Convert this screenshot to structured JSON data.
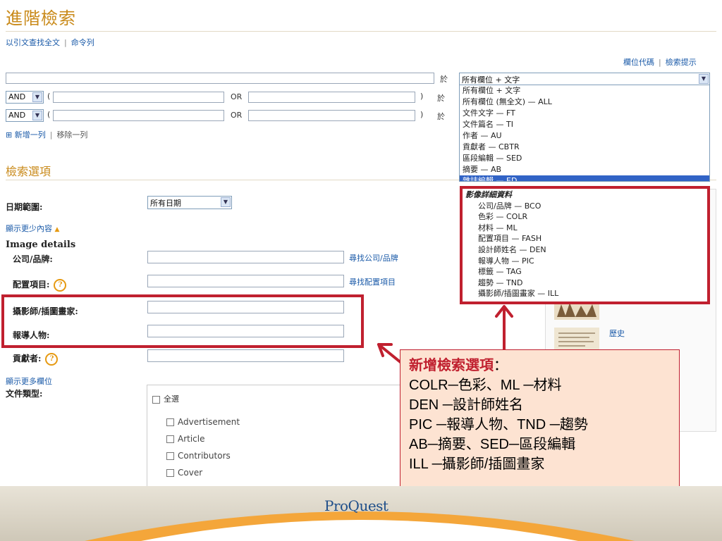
{
  "header": {
    "title": "進階檢索",
    "link_citation": "以引文查找全文",
    "link_command": "命令列",
    "link_field_codes": "欄位代碼",
    "link_search_tips": "檢索提示"
  },
  "search_rows": {
    "in_label": "於",
    "field_select_value": "所有欄位 + 文字",
    "row2": {
      "operator": "AND",
      "paren_open": "(",
      "or_label": "OR",
      "paren_close": ")"
    },
    "row3": {
      "operator": "AND",
      "paren_open": "(",
      "or_label": "OR",
      "paren_close": ")"
    },
    "add_row": "新增一列",
    "add_row_symbol": "⊞",
    "remove_row": "移除一列"
  },
  "field_dropdown": {
    "items": [
      "所有欄位 + 文字",
      "所有欄位 (無全文) — ALL",
      "文件文字 — FT",
      "文件篇名 — TI",
      "作者 — AU",
      "貢獻者 — CBTR",
      "區段編輯 — SED",
      "摘要 — AB",
      "雜誌編輯 — ED"
    ],
    "image_details_heading": "影像詳細資料",
    "image_detail_items": [
      "公司/品牌 — BCO",
      "色彩 — COLR",
      "材料 — ML",
      "配置項目 — FASH",
      "設計師姓名 — DEN",
      "報導人物 — PIC",
      "標籤 — TAG",
      "趨勢 — TND",
      "攝影師/插圖畫家 — ILL"
    ]
  },
  "search_options": {
    "heading": "檢索選項",
    "date_range_label": "日期範圍:",
    "date_range_value": "所有日期",
    "show_less": "顯示更少內容",
    "image_details_label": "Image details",
    "company_label": "公司/品牌:",
    "company_link": "尋找公司/品牌",
    "config_label": "配置項目:",
    "config_link": "尋找配置項目",
    "photographer_label": "攝影師/插圖畫家:",
    "people_label": "報導人物:",
    "contributor_label": "貢獻者:",
    "show_more_fields": "顯示更多欄位",
    "doc_type_label": "文件類型:",
    "select_all": "全選",
    "doc_types": [
      "Advertisement",
      "Article",
      "Contributors",
      "Cover"
    ],
    "help_glyph": "?"
  },
  "side_panel": {
    "history_label": "歷史"
  },
  "callout": {
    "title": "新增檢索選項",
    "title_suffix": "：",
    "lines": [
      "COLR─色彩、ML ─材料",
      "DEN ─設計師姓名",
      "PIC ─報導人物、TND ─趨勢",
      "AB─摘要、SED─區段編輯",
      "ILL ─攝影師/插圖畫家"
    ]
  },
  "footer": {
    "logo_text": "ProQuest"
  },
  "colors": {
    "accent_title": "#c98a1a",
    "highlight_red": "#c0202f",
    "link": "#1a5aa8",
    "callout_bg": "#fde3d2"
  }
}
